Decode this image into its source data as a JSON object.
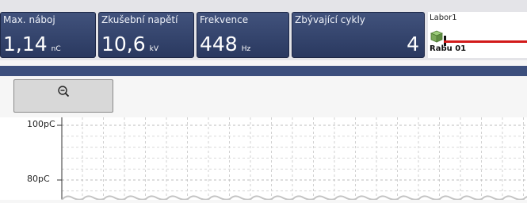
{
  "tiles": [
    {
      "label": "Max. náboj",
      "value": "1,14",
      "unit": "nC"
    },
    {
      "label": "Zkušební napětí",
      "value": "10,6",
      "unit": "kV"
    },
    {
      "label": "Frekvence",
      "value": "448",
      "unit": "Hz"
    },
    {
      "label": "Zbývající cykly",
      "value": "4",
      "unit": ""
    }
  ],
  "labor": {
    "title": "Labor1",
    "device_name": "Rabu 01",
    "device_icon": "device-stack-icon"
  },
  "toolbar": {
    "zoom_icon": "zoom-out-icon"
  },
  "chart_data": {
    "type": "line",
    "ylabels": [
      "100pC",
      "80pC"
    ],
    "yvalues": [
      100,
      80
    ],
    "grid": true,
    "series": []
  },
  "colors": {
    "tile_bg": "#34466f",
    "bluebar": "#3c4f7d",
    "cable": "#d21a1a"
  }
}
